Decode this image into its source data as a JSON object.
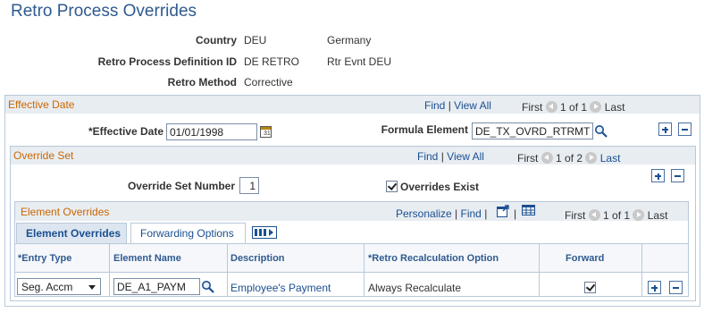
{
  "page": {
    "title": "Retro Process Overrides"
  },
  "header": {
    "country_label": "Country",
    "country_code": "DEU",
    "country_name": "Germany",
    "definition_label": "Retro Process Definition ID",
    "definition_code": "DE RETRO",
    "definition_name": "Rtr Evnt DEU",
    "method_label": "Retro Method",
    "method_value": "Corrective"
  },
  "effective": {
    "section_title": "Effective Date",
    "find": "Find",
    "separator": "|",
    "view_all": "View All",
    "first": "First",
    "count": "1 of 1",
    "last": "Last",
    "date_label": "*Effective Date",
    "date_value": "01/01/1998",
    "formula_label": "Formula Element",
    "formula_value": "DE_TX_OVRD_RTRMTH"
  },
  "override_set": {
    "section_title": "Override Set",
    "find": "Find",
    "separator": "|",
    "view_all": "View All",
    "first": "First",
    "count": "1 of 2",
    "last": "Last",
    "number_label": "Override Set Number",
    "number_value": "1",
    "exist_label": "Overrides Exist"
  },
  "element_overrides": {
    "section_title": "Element Overrides",
    "personalize": "Personalize",
    "separator": "|",
    "find": "Find",
    "first": "First",
    "count": "1 of 1",
    "last": "Last",
    "tabs": [
      "Element Overrides",
      "Forwarding Options"
    ],
    "columns": [
      "*Entry Type",
      "Element Name",
      "Description",
      "*Retro Recalculation Option",
      "Forward"
    ],
    "rows": [
      {
        "entry_type": "Seg. Accm",
        "element_name": "DE_A1_PAYM",
        "description": "Employee's Payment",
        "recalc_option": "Always Recalculate",
        "forward": true
      }
    ]
  }
}
